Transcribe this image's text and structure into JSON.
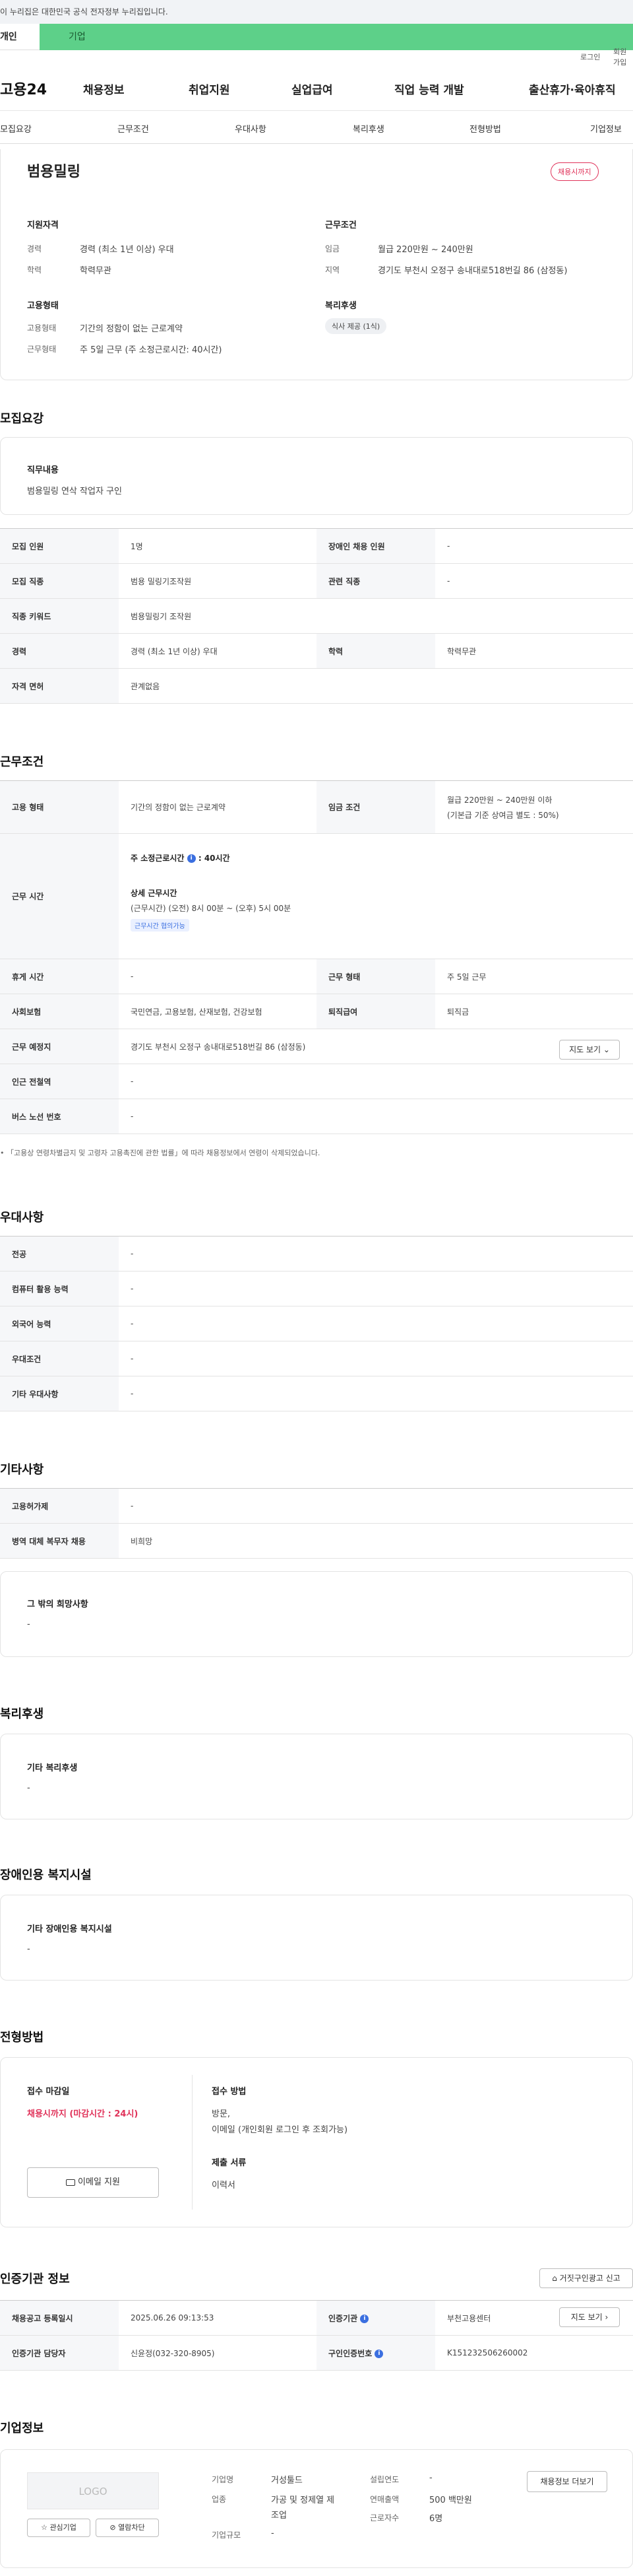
{
  "gov_banner": "이 누리집은 대한민국 공식 전자정부 누리집입니다.",
  "user_tabs": {
    "personal": "개인",
    "company": "기업"
  },
  "top_links": {
    "login": "로그인",
    "join": "회원가입"
  },
  "gnb": {
    "logo": "고용24",
    "menu": [
      "채용정보",
      "취업지원",
      "실업급여",
      "직업 능력 개발",
      "출산휴가·육아휴직"
    ]
  },
  "subnav": [
    "모집요강",
    "근무조건",
    "우대사항",
    "복리후생",
    "전형방법",
    "기업정보"
  ],
  "summary": {
    "company": "범용밀링",
    "deadline_badge": "채용시까지",
    "qualification_title": "지원자격",
    "career_label": "경력",
    "career_value": "경력 (최소 1년 이상) 우대",
    "education_label": "학력",
    "education_value": "학력무관",
    "condition_title": "근무조건",
    "wage_label": "임금",
    "wage_value": "월급 220만원 ~ 240만원",
    "region_label": "지역",
    "region_value": "경기도 부천시 오정구 송내대로518번길 86 (삼정동)",
    "employment_title": "고용형태",
    "emp_type_label": "고용형태",
    "emp_type_value": "기간의 정함이 없는 근로계약",
    "work_type_label": "근무형태",
    "work_type_value": "주 5일 근무 (주 소정근로시간: 40시간)",
    "welfare_title": "복리후생",
    "welfare_tag": "식사 제공 (1식)"
  },
  "recruit": {
    "title": "모집요강",
    "job_desc_label": "직무내용",
    "job_desc_value": "범용밀링 연삭 작업자 구인",
    "rows": [
      {
        "k1": "모집 인원",
        "v1": "1명",
        "k2": "장애인 채용 인원",
        "v2": "-"
      },
      {
        "k1": "모집 직종",
        "v1": "범용 밀링기조작원",
        "k2": "관련 직종",
        "v2": "-"
      },
      {
        "k1": "직종 키워드",
        "v1": "범용밀링기 조작원"
      },
      {
        "k1": "경력",
        "v1": "경력 (최소 1년 이상) 우대",
        "k2": "학력",
        "v2": "학력무관"
      },
      {
        "k1": "자격 면허",
        "v1": "관계없음"
      }
    ]
  },
  "work": {
    "title": "근무조건",
    "emp_type_label": "고용 형태",
    "emp_type_value": "기간의 정함이 없는 근로계약",
    "wage_label": "임금 조건",
    "wage_value": "월급 220만원 ~ 240만원 이하",
    "wage_note": "(기본급 기준 상여금 별도 : 50%)",
    "hours_label": "근무 시간",
    "weekly_hours_label": "주 소정근로시간",
    "weekly_hours_value": ": 40시간",
    "detail_hours_label": "상세 근무시간",
    "detail_hours_value": "(근무시간) (오전) 8시 00분 ~ (오후) 5시 00분",
    "hours_badge": "근무시간 협의가능",
    "break_label": "휴게 시간",
    "break_value": "-",
    "work_form_label": "근무 형태",
    "work_form_value": "주 5일 근무",
    "insurance_label": "사회보험",
    "insurance_value": "국민연금, 고용보험, 산재보험, 건강보험",
    "severance_label": "퇴직급여",
    "severance_value": "퇴직금",
    "location_label": "근무 예정지",
    "location_value": "경기도 부천시 오정구 송내대로518번길 86 (삼정동)",
    "map_button": "지도 보기",
    "subway_label": "인근 전철역",
    "subway_value": "-",
    "bus_label": "버스 노선 번호",
    "bus_value": "-",
    "notice": "「고용상 연령차별금지 및 고령자 고용촉진에 관한 법률」에 따라 채용정보에서 연령이 삭제되었습니다."
  },
  "preference": {
    "title": "우대사항",
    "rows": [
      {
        "k": "전공",
        "v": "-"
      },
      {
        "k": "컴퓨터 활용 능력",
        "v": "-"
      },
      {
        "k": "외국어 능력",
        "v": "-"
      },
      {
        "k": "우대조건",
        "v": "-"
      },
      {
        "k": "기타 우대사항",
        "v": "-"
      }
    ]
  },
  "etc": {
    "title": "기타사항",
    "rows": [
      {
        "k": "고용허가제",
        "v": "-"
      },
      {
        "k": "병역 대체 복무자 채용",
        "v": "비희망"
      }
    ],
    "wish_label": "그 밖의 희망사항",
    "wish_value": "-"
  },
  "welfare": {
    "title": "복리후생",
    "label": "기타 복리후생",
    "value": "-"
  },
  "disability": {
    "title": "장애인용 복지시설",
    "label": "기타 장애인용 복지시설",
    "value": "-"
  },
  "selection": {
    "title": "전형방법",
    "deadline_label": "접수 마감일",
    "deadline_value": "채용시까지 (마감시간 : 24시)",
    "email_button": "이메일 지원",
    "method_label": "접수 방법",
    "method_value1": "방문,",
    "method_value2": "이메일 (개인회원 로그인 후 조회가능)",
    "docs_label": "제출 서류",
    "docs_value": "이력서"
  },
  "cert": {
    "title": "인증기관 정보",
    "report_button": "거짓구인광고 신고",
    "reg_date_label": "채용공고 등록일시",
    "reg_date_value": "2025.06.26 09:13:53",
    "agency_label": "인증기관",
    "agency_value": "부천고용센터",
    "map_button": "지도 보기",
    "manager_label": "인증기관 담당자",
    "manager_value": "신윤정(032-320-8905)",
    "notice_no_label": "구인인증번호",
    "notice_no_value": "K151232506260002"
  },
  "company": {
    "title": "기업정보",
    "logo_text": "LOGO",
    "fav_button": "관심기업",
    "block_button": "열람차단",
    "name_label": "기업명",
    "name_value": "거성툴드",
    "industry_label": "업종",
    "industry_value1": "가공 및 정제열 제",
    "industry_value2": "조업",
    "size_label": "기업규모",
    "size_value": "-",
    "founded_label": "설립연도",
    "founded_value": "-",
    "sales_label": "연매출액",
    "sales_value": "500 백만원",
    "employees_label": "근로자수",
    "employees_value": "6명",
    "other_jobs_button": "채용정보 더보기"
  }
}
